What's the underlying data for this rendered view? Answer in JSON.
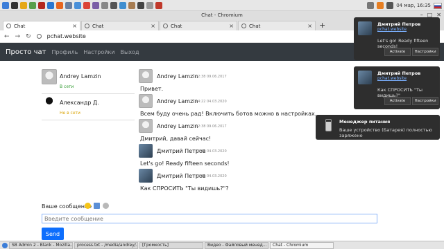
{
  "os": {
    "clock": "04 мар, 16:35",
    "tray_icons": [
      "audio-icon",
      "battery-icon",
      "network-icon"
    ]
  },
  "browser": {
    "window_title": "Chat - Chromium",
    "tabs": [
      {
        "label": "Chat",
        "active": true
      },
      {
        "label": "Chat",
        "active": false
      },
      {
        "label": "Chat",
        "active": false
      },
      {
        "label": "Chat",
        "active": false
      }
    ],
    "url": "pchat.website"
  },
  "navbar": {
    "brand": "Просто чат",
    "links": [
      "Профиль",
      "Настройки",
      "Выход"
    ]
  },
  "contacts": [
    {
      "name": "Andrey Lamzin",
      "status": "В сети",
      "online": true,
      "avatar": "gray"
    },
    {
      "name": "Александр Д.",
      "status": "Не в сети",
      "online": false,
      "avatar": "black"
    }
  ],
  "messages": [
    {
      "author": "Andrey Lamzin",
      "time": "02:38 09.06.2017",
      "text": "Привет.",
      "avatar": "gray"
    },
    {
      "author": "Andrey Lamzin",
      "time": "14:22 04.03.2020",
      "text": "Всем буду очень рад! Включить ботов можно в настройках.",
      "avatar": "gray"
    },
    {
      "author": "Andrey Lamzin",
      "time": "02:38 09.06.2017",
      "text": "Дмитрий, давай сейчас!",
      "avatar": "gray"
    },
    {
      "author": "Дмитрий Петров",
      "time": "16:35 04.03.2020",
      "text": "Let's go! Ready fifteen seconds!",
      "avatar": "photo"
    },
    {
      "author": "Дмитрий Петров",
      "time": "16:35 04.03.2020",
      "text": "Как СПРОСИТЬ \"Ты видишь?\"?",
      "avatar": "photo"
    }
  ],
  "composer": {
    "label": "Ваше сообщение",
    "placeholder": "Введите сообщение",
    "send_label": "Send"
  },
  "notifications": [
    {
      "title": "Дмитрий Петров",
      "site": "pchat.website",
      "text": "Let's go! Ready fifteen seconds!",
      "activate": "Activate",
      "settings": "Настройки"
    },
    {
      "title": "Дмитрий Петров",
      "site": "pchat.website",
      "text": "Как СПРОСИТЬ \"Ты видишь?\"",
      "activate": "Activate",
      "settings": "Настройки"
    }
  ],
  "power": {
    "title": "Менеджер питания",
    "text": "Ваше устройство (Батарея) полностью заряжено"
  },
  "taskbar": [
    {
      "label": "SB Admin 2 - Blank - Mozilla...",
      "active": false
    },
    {
      "label": "process.txt - /media/andrey/...",
      "active": false
    },
    {
      "label": "[Громкость]",
      "active": false
    },
    {
      "label": "Видео - Файловый менед...",
      "active": false
    },
    {
      "label": "Chat - Chromium",
      "active": true
    }
  ],
  "colors": {
    "navbar_bg": "#343a40",
    "send_button": "#0d6efd",
    "online": "#2f9a2f",
    "offline": "#d9a200",
    "notification_bg": "#2e2e2e"
  }
}
